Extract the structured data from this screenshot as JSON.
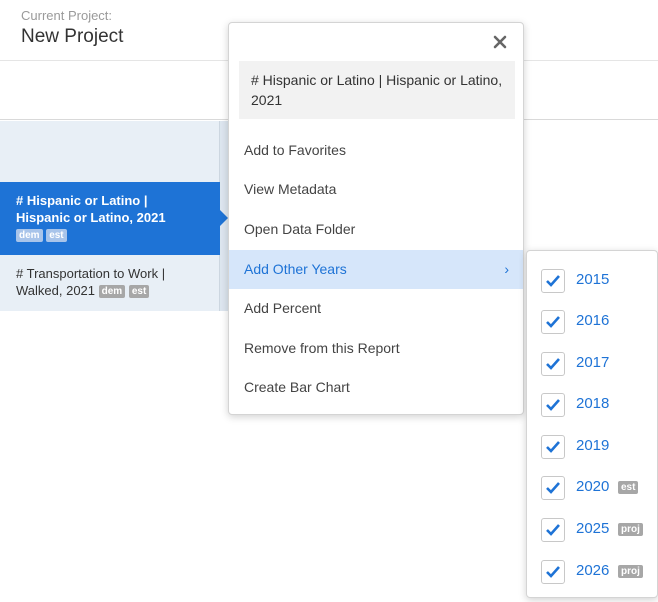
{
  "header": {
    "caption": "Current Project:",
    "project_name": "New Project"
  },
  "variables": [
    {
      "label_line1": "# Hispanic or Latino |",
      "label_line2": "Hispanic or Latino, 2021",
      "badges": [
        "dem",
        "est"
      ],
      "selected": true
    },
    {
      "label_line1": "# Transportation to Work |",
      "label_line2": "Walked, 2021",
      "badges": [
        "dem",
        "est"
      ],
      "selected": false
    }
  ],
  "menu": {
    "title": "# Hispanic or Latino | Hispanic or Latino, 2021",
    "close_icon": "close-icon",
    "items": [
      {
        "label": "Add to Favorites"
      },
      {
        "label": "View Metadata"
      },
      {
        "label": "Open Data Folder"
      },
      {
        "label": "Add Other Years",
        "has_submenu": true,
        "highlighted": true
      },
      {
        "label": "Add Percent"
      },
      {
        "label": "Remove from this Report"
      },
      {
        "label": "Create Bar Chart"
      }
    ],
    "submenu_indicator": "›"
  },
  "years": [
    {
      "year": "2015",
      "checked": true,
      "badge": ""
    },
    {
      "year": "2016",
      "checked": true,
      "badge": ""
    },
    {
      "year": "2017",
      "checked": true,
      "badge": ""
    },
    {
      "year": "2018",
      "checked": true,
      "badge": ""
    },
    {
      "year": "2019",
      "checked": true,
      "badge": ""
    },
    {
      "year": "2020",
      "checked": true,
      "badge": "est"
    },
    {
      "year": "2025",
      "checked": true,
      "badge": "proj"
    },
    {
      "year": "2026",
      "checked": true,
      "badge": "proj"
    }
  ],
  "colors": {
    "accent": "#1e73d6",
    "highlight_bg": "#d6e6fa",
    "panel_bg": "#e8eff6",
    "badge_bg": "#a7a7a7"
  }
}
